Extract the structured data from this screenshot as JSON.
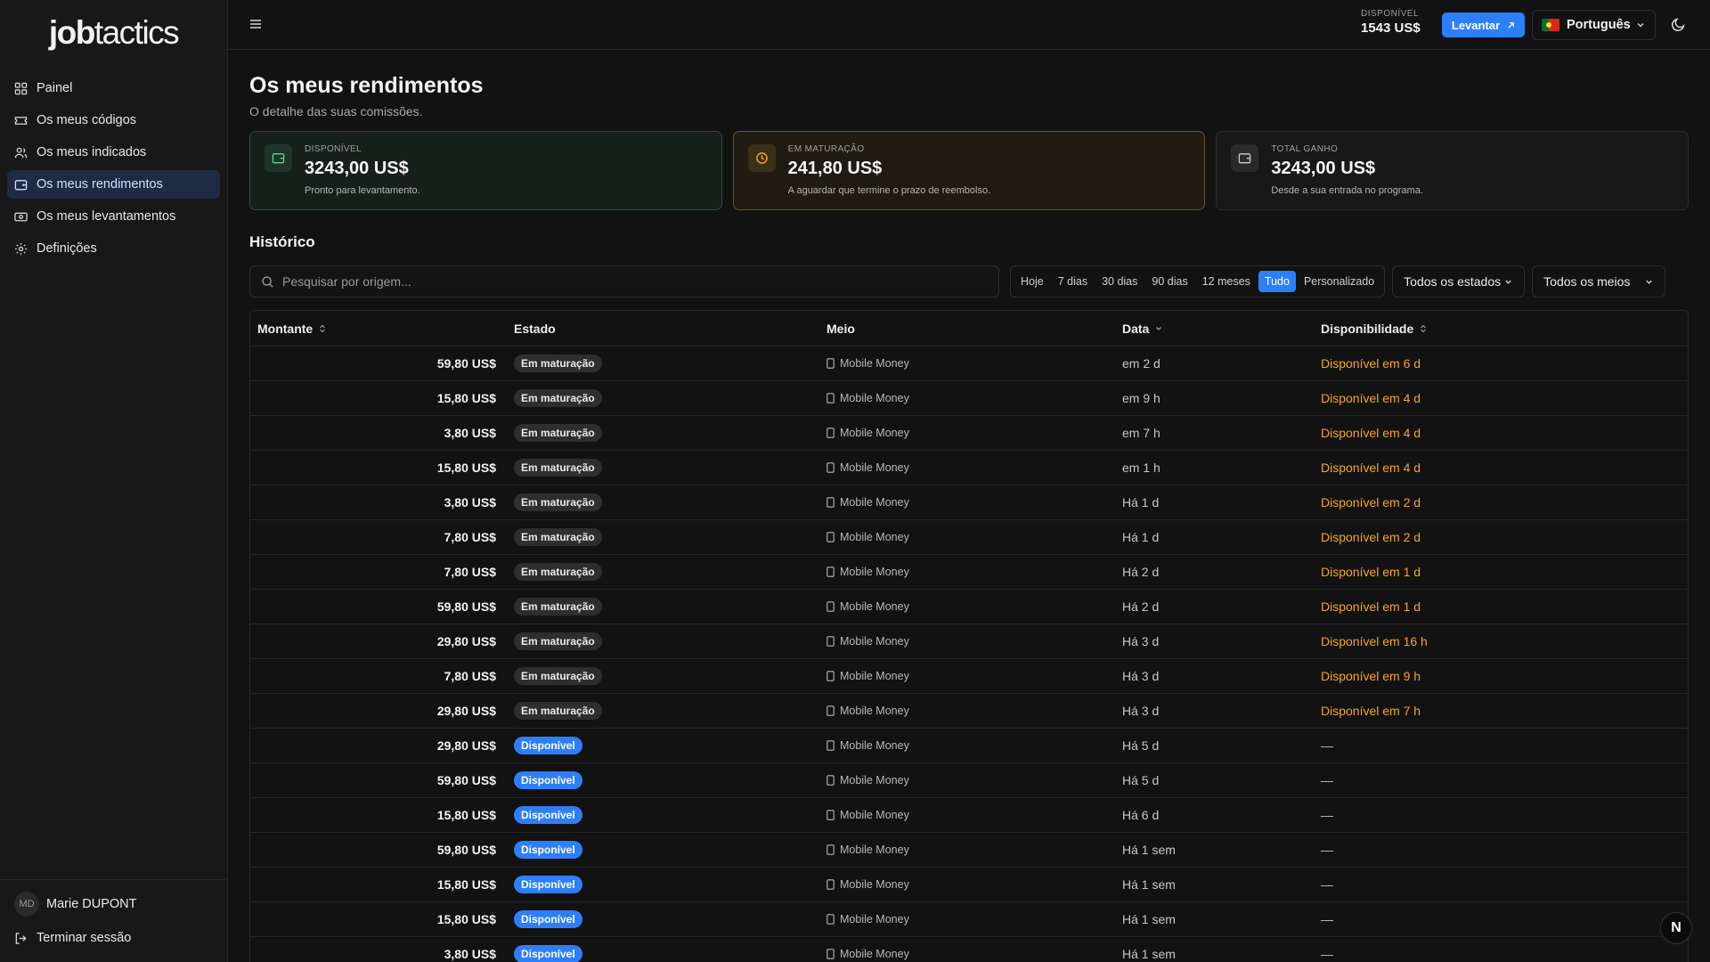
{
  "app": {
    "logo_bold": "job",
    "logo_light": "tactics"
  },
  "sidebar": {
    "items": [
      {
        "label": "Painel",
        "icon": "dashboard-icon"
      },
      {
        "label": "Os meus códigos",
        "icon": "ticket-icon"
      },
      {
        "label": "Os meus indicados",
        "icon": "users-icon"
      },
      {
        "label": "Os meus rendimentos",
        "icon": "wallet-icon",
        "active": true
      },
      {
        "label": "Os meus levantamentos",
        "icon": "banknote-icon"
      },
      {
        "label": "Definições",
        "icon": "gear-icon"
      }
    ],
    "user": {
      "initials": "MD",
      "name": "Marie DUPONT"
    },
    "logout_label": "Terminar sessão"
  },
  "topbar": {
    "available_label": "DISPONÍVEL",
    "available_value": "1543 US$",
    "withdraw_label": "Levantar",
    "language": "Português"
  },
  "page": {
    "title": "Os meus rendimentos",
    "subtitle": "O detalhe das suas comissões."
  },
  "cards": [
    {
      "label": "DISPONÍVEL",
      "value": "3243,00 US$",
      "desc": "Pronto para levantamento.",
      "accent": "#27513e"
    },
    {
      "label": "EM MATURAÇÃO",
      "value": "241,80 US$",
      "desc": "A aguardar que termine o prazo de reembolso.",
      "accent": "#6b5221"
    },
    {
      "label": "TOTAL GANHO",
      "value": "3243,00 US$",
      "desc": "Desde a sua entrada no programa."
    }
  ],
  "history": {
    "title": "Histórico",
    "search_placeholder": "Pesquisar por origem...",
    "periods": [
      "Hoje",
      "7 dias",
      "30 dias",
      "90 dias",
      "12 meses",
      "Tudo",
      "Personalizado"
    ],
    "active_period": "Tudo",
    "state_filter": "Todos os estados",
    "method_filter": "Todos os meios",
    "columns": {
      "amount": "Montante",
      "state": "Estado",
      "method": "Meio",
      "date": "Data",
      "availability": "Disponibilidade"
    },
    "rows": [
      {
        "amount": "59,80 US$",
        "state": "Em maturação",
        "method": "Mobile Money",
        "date": "em 2 d",
        "availability": "Disponível em 6 d"
      },
      {
        "amount": "15,80 US$",
        "state": "Em maturação",
        "method": "Mobile Money",
        "date": "em 9 h",
        "availability": "Disponível em 4 d"
      },
      {
        "amount": "3,80 US$",
        "state": "Em maturação",
        "method": "Mobile Money",
        "date": "em 7 h",
        "availability": "Disponível em 4 d"
      },
      {
        "amount": "15,80 US$",
        "state": "Em maturação",
        "method": "Mobile Money",
        "date": "em 1 h",
        "availability": "Disponível em 4 d"
      },
      {
        "amount": "3,80 US$",
        "state": "Em maturação",
        "method": "Mobile Money",
        "date": "Há 1 d",
        "availability": "Disponível em 2 d"
      },
      {
        "amount": "7,80 US$",
        "state": "Em maturação",
        "method": "Mobile Money",
        "date": "Há 1 d",
        "availability": "Disponível em 2 d"
      },
      {
        "amount": "7,80 US$",
        "state": "Em maturação",
        "method": "Mobile Money",
        "date": "Há 2 d",
        "availability": "Disponível em 1 d"
      },
      {
        "amount": "59,80 US$",
        "state": "Em maturação",
        "method": "Mobile Money",
        "date": "Há 2 d",
        "availability": "Disponível em 1 d"
      },
      {
        "amount": "29,80 US$",
        "state": "Em maturação",
        "method": "Mobile Money",
        "date": "Há 3 d",
        "availability": "Disponível em 16 h"
      },
      {
        "amount": "7,80 US$",
        "state": "Em maturação",
        "method": "Mobile Money",
        "date": "Há 3 d",
        "availability": "Disponível em 9 h"
      },
      {
        "amount": "29,80 US$",
        "state": "Em maturação",
        "method": "Mobile Money",
        "date": "Há 3 d",
        "availability": "Disponível em 7 h"
      },
      {
        "amount": "29,80 US$",
        "state": "Disponível",
        "method": "Mobile Money",
        "date": "Há 5 d",
        "availability": "—"
      },
      {
        "amount": "59,80 US$",
        "state": "Disponível",
        "method": "Mobile Money",
        "date": "Há 5 d",
        "availability": "—"
      },
      {
        "amount": "15,80 US$",
        "state": "Disponível",
        "method": "Mobile Money",
        "date": "Há 6 d",
        "availability": "—"
      },
      {
        "amount": "59,80 US$",
        "state": "Disponível",
        "method": "Mobile Money",
        "date": "Há 1 sem",
        "availability": "—"
      },
      {
        "amount": "15,80 US$",
        "state": "Disponível",
        "method": "Mobile Money",
        "date": "Há 1 sem",
        "availability": "—"
      },
      {
        "amount": "15,80 US$",
        "state": "Disponível",
        "method": "Mobile Money",
        "date": "Há 1 sem",
        "availability": "—"
      },
      {
        "amount": "3,80 US$",
        "state": "Disponível",
        "method": "Mobile Money",
        "date": "Há 1 sem",
        "availability": "—"
      }
    ]
  },
  "floating_badge": "N",
  "colors": {
    "accent": "#2d7ff9",
    "pending": "#f5a524",
    "background": "#121212"
  }
}
